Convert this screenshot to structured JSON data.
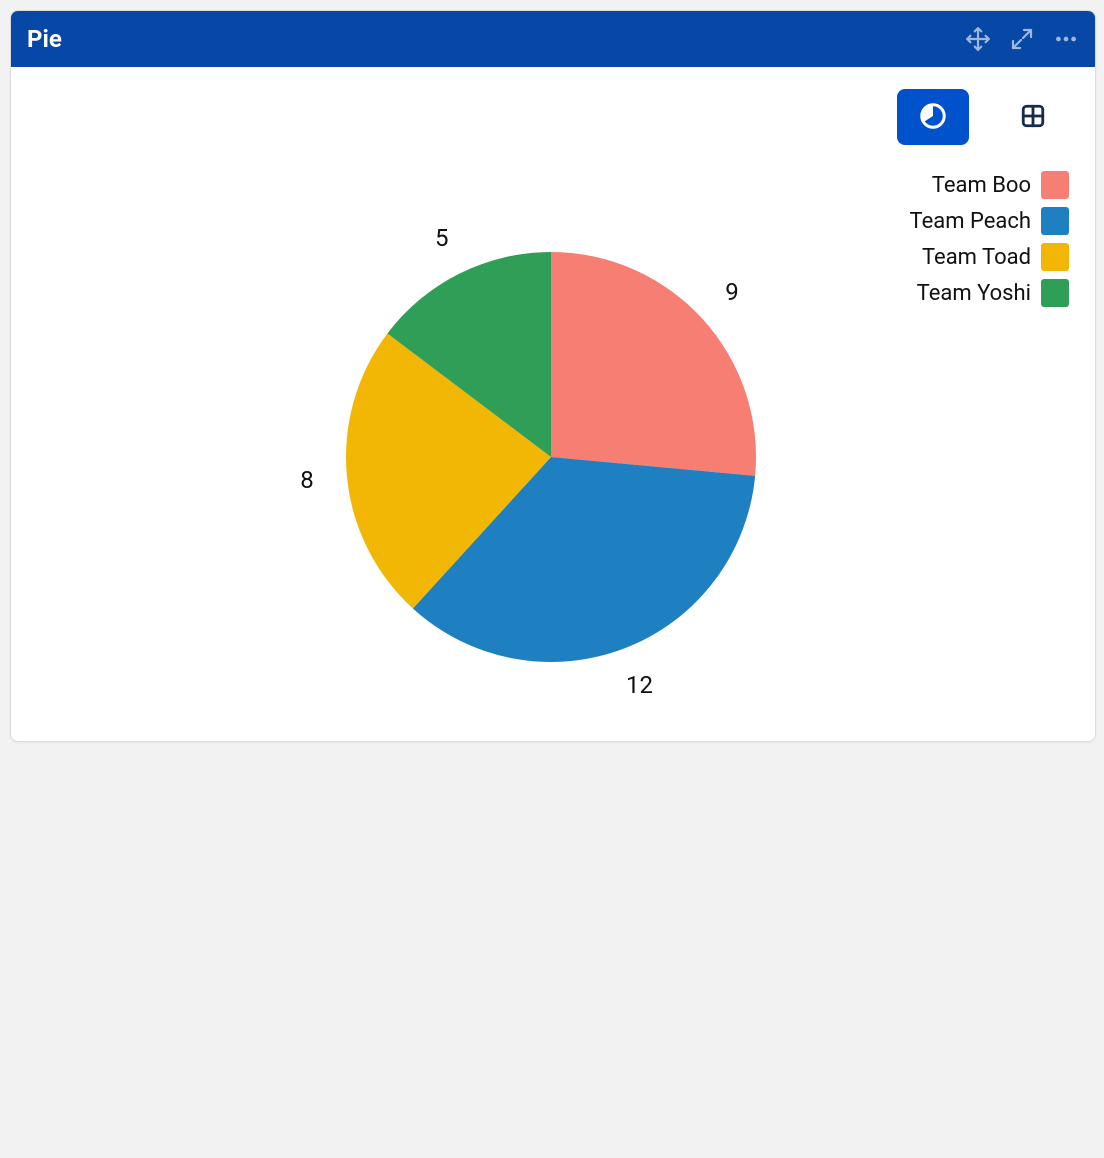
{
  "panel": {
    "title": "Pie"
  },
  "view_toggle": {
    "chart_active": true
  },
  "legend": [
    {
      "label": "Team Boo",
      "color": "#F77E72"
    },
    {
      "label": "Team Peach",
      "color": "#1E80C1"
    },
    {
      "label": "Team Toad",
      "color": "#F2B705"
    },
    {
      "label": "Team Yoshi",
      "color": "#2F9E57"
    }
  ],
  "chart_data": {
    "type": "pie",
    "title": "Pie",
    "categories": [
      "Team Boo",
      "Team Peach",
      "Team Toad",
      "Team Yoshi"
    ],
    "values": [
      9,
      12,
      8,
      5
    ],
    "colors": [
      "#F77E72",
      "#1E80C1",
      "#F2B705",
      "#2F9E57"
    ]
  }
}
